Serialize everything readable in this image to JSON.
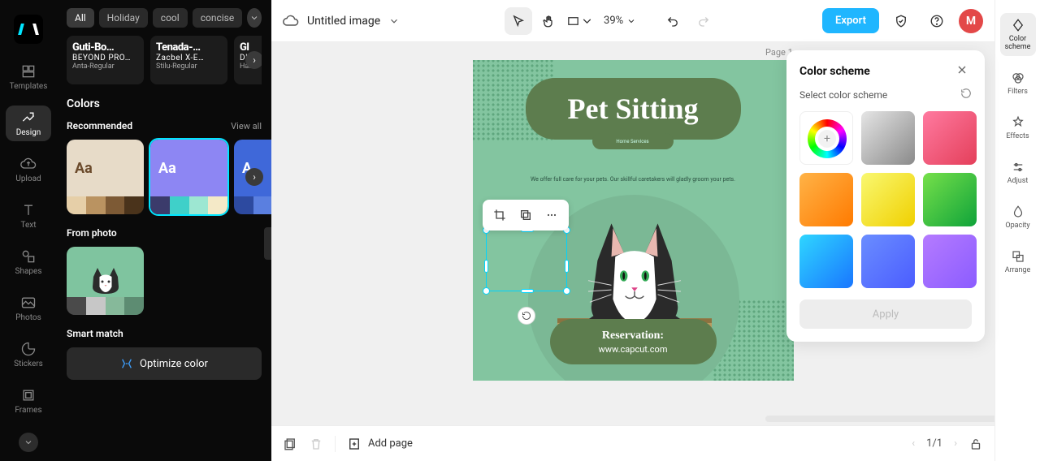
{
  "leftNav": {
    "items": [
      {
        "label": "Templates"
      },
      {
        "label": "Design"
      },
      {
        "label": "Upload"
      },
      {
        "label": "Text"
      },
      {
        "label": "Shapes"
      },
      {
        "label": "Photos"
      },
      {
        "label": "Stickers"
      },
      {
        "label": "Frames"
      }
    ]
  },
  "tabs": [
    "All",
    "Holiday",
    "cool",
    "concise"
  ],
  "fontCards": [
    {
      "l1": "Guti-Bo…",
      "l2": "BEYOND PRO…",
      "l3": "Anta-Regular"
    },
    {
      "l1": "Tenada-…",
      "l2": "Zacbel X-E…",
      "l3": "Stilu-Regular"
    },
    {
      "l1": "Gl",
      "l2": "Dl",
      "l3": "Ham"
    }
  ],
  "colorsSection": {
    "title": "Colors"
  },
  "recommended": {
    "title": "Recommended",
    "viewAll": "View all",
    "cards": [
      {
        "top": "#e7dbc8",
        "text": "#6b4a2b",
        "bars": [
          "#e6cfa8",
          "#ba9361",
          "#7d5a35",
          "#4a331b"
        ]
      },
      {
        "top": "#8d86f3",
        "text": "#ffffff",
        "bars": [
          "#3b3b6b",
          "#3fd0c9",
          "#9de7d2",
          "#f4e9c7"
        ]
      },
      {
        "top": "#3f68d9",
        "text": "#ffffff",
        "bars": [
          "#2d4aa0",
          "#5a7fe0",
          "#8aa6ea",
          "#c6d3f3"
        ]
      }
    ]
  },
  "fromPhoto": {
    "title": "From photo",
    "bars": [
      "#4a4a4a",
      "#c7c7c7",
      "#86b99a",
      "#5d8c72"
    ]
  },
  "smartMatch": {
    "title": "Smart match",
    "button": "Optimize color"
  },
  "topBar": {
    "title": "Untitled image",
    "zoom": "39%",
    "export": "Export",
    "avatar": "M"
  },
  "page": {
    "label": "Page 1"
  },
  "canvas": {
    "title": "Pet Sitting",
    "subtitle": "Home Services",
    "desc": "We offer full care for your pets. Our skillful caretakers will gladly groom your pets.",
    "reservation": "Reservation:",
    "url": "www.capcut.com"
  },
  "colorScheme": {
    "title": "Color scheme",
    "subtitle": "Select color scheme",
    "apply": "Apply",
    "swatches": [
      "wheel",
      "linear-gradient(135deg,#e5e5e5,#8a8a8a)",
      "linear-gradient(135deg,#ff7aa0,#e43f5a)",
      "linear-gradient(135deg,#ffb347,#ff7a00)",
      "linear-gradient(135deg,#f9f871,#f0d000)",
      "linear-gradient(135deg,#76e04a,#0fa33a)",
      "linear-gradient(135deg,#2fd6ff,#1976ff)",
      "linear-gradient(135deg,#6a8dff,#4b5dff)",
      "linear-gradient(135deg,#b57bff,#8b5cff)"
    ]
  },
  "rightRail": [
    {
      "label": "Color scheme"
    },
    {
      "label": "Filters"
    },
    {
      "label": "Effects"
    },
    {
      "label": "Adjust"
    },
    {
      "label": "Opacity"
    },
    {
      "label": "Arrange"
    }
  ],
  "bottomBar": {
    "addPage": "Add page",
    "pages": "1/1"
  }
}
